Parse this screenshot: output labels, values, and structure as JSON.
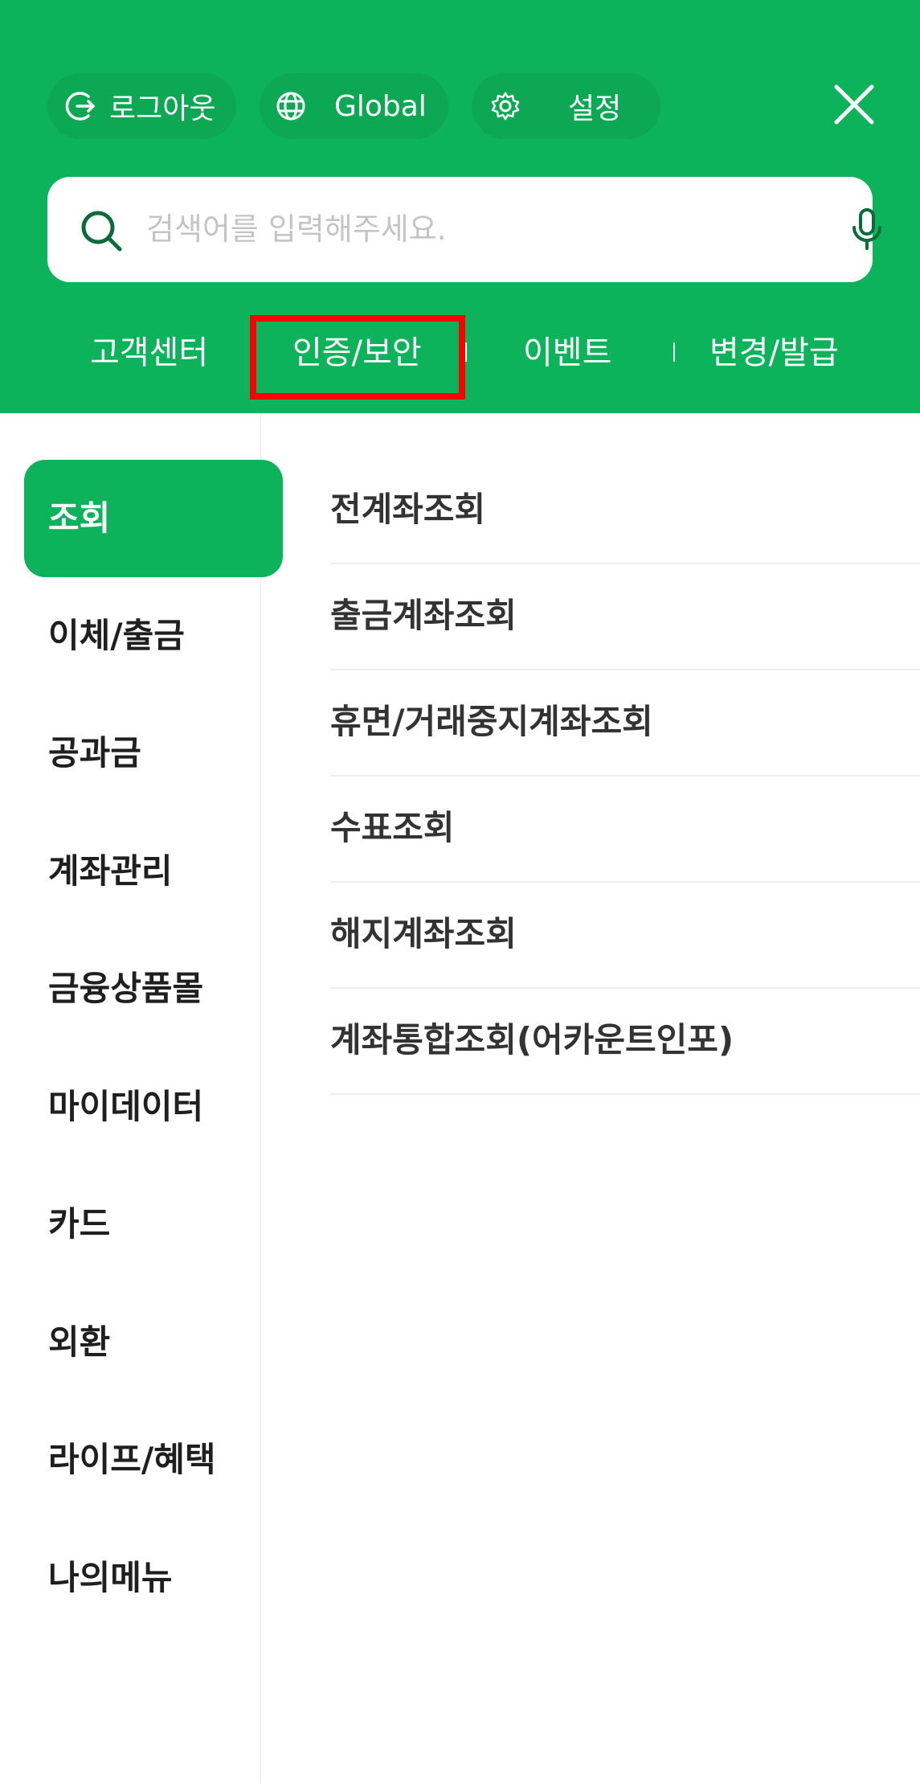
{
  "header": {
    "logout_label": "로그아웃",
    "global_label": "Global",
    "settings_label": "설정",
    "search_placeholder": "검색어를 입력해주세요.",
    "quick_links": [
      "고객센터",
      "인증/보안",
      "이벤트",
      "변경/발급"
    ],
    "highlighted_link": "인증/보안"
  },
  "sidebar": {
    "items": [
      "조회",
      "이체/출금",
      "공과금",
      "계좌관리",
      "금융상품몰",
      "마이데이터",
      "카드",
      "외환",
      "라이프/혜택",
      "나의메뉴"
    ],
    "active": "조회"
  },
  "submenu": {
    "items": [
      "전계좌조회",
      "출금계좌조회",
      "휴면/거래중지계좌조회",
      "수표조회",
      "해지계좌조회",
      "계좌통합조회(어카운트인포)"
    ]
  },
  "colors": {
    "brand_green": "#0db35a",
    "highlight_red": "#ff0000"
  },
  "icons": [
    "logout-icon",
    "globe-icon",
    "gear-icon",
    "close-icon",
    "search-icon",
    "microphone-icon"
  ]
}
